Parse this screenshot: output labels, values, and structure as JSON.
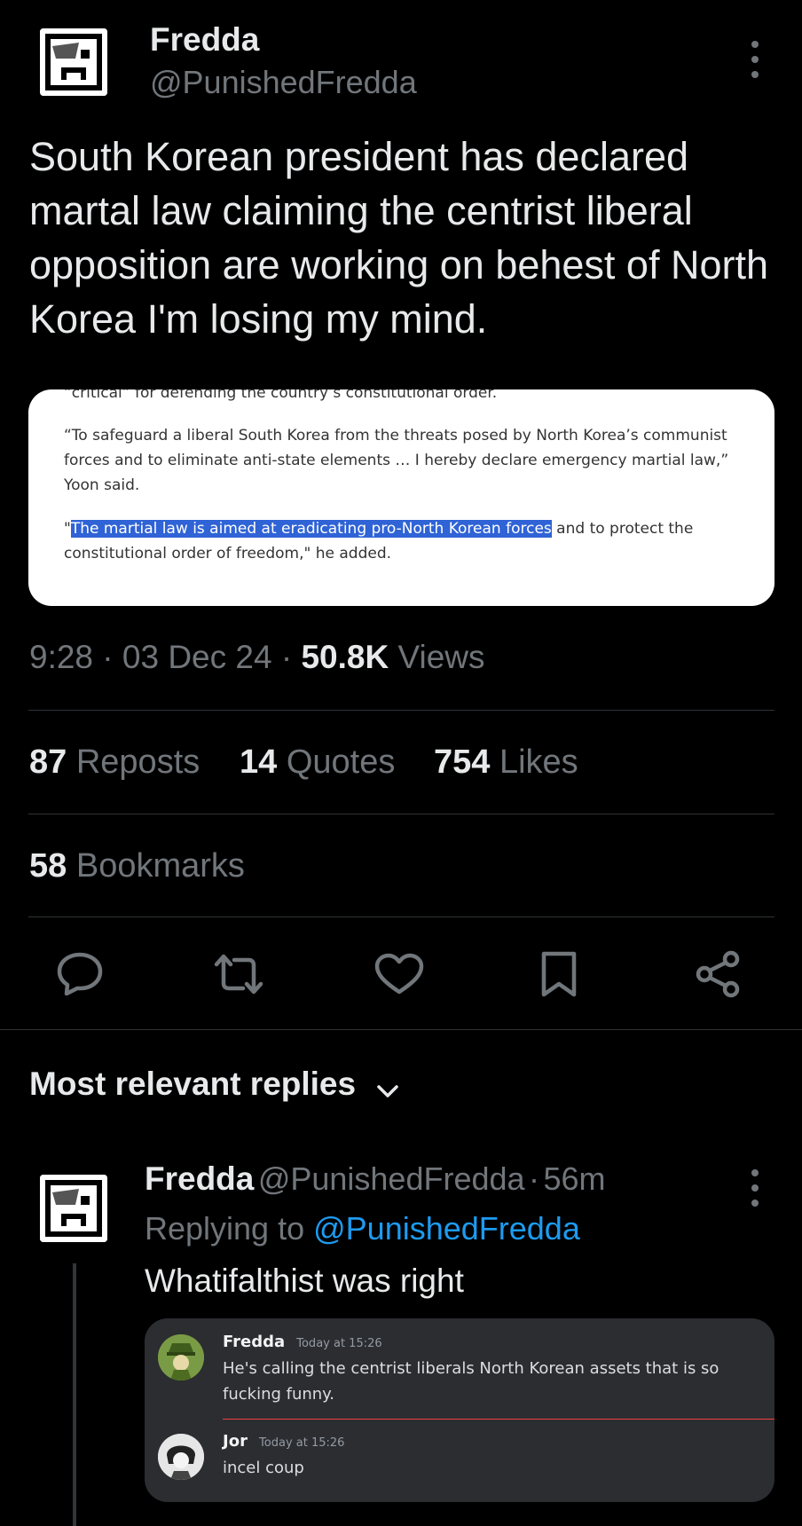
{
  "tweet": {
    "author_name": "Fredda",
    "author_handle": "@PunishedFredda",
    "text": "South Korean president has declared martal law claiming the centrist liberal opposition are working on behest of North Korea I'm losing my mind.",
    "embed": {
      "cut_line": "“critical” for defending the country’s constitutional order.",
      "para1": "“To safeguard a liberal South Korea from the threats posed by North Korea’s communist forces and to eliminate anti-state elements … I hereby declare emergency martial law,” Yoon said.",
      "quote_open": "\"",
      "highlight": "The martial law is aimed at eradicating pro-North Korean forces",
      "para2_rest": " and to protect the constitutional order of freedom,\" he added."
    },
    "time": "9:28",
    "date": "03 Dec 24",
    "views_count": "50.8K",
    "views_label": "Views",
    "reposts_count": "87",
    "reposts_label": "Reposts",
    "quotes_count": "14",
    "quotes_label": "Quotes",
    "likes_count": "754",
    "likes_label": "Likes",
    "bookmarks_count": "58",
    "bookmarks_label": "Bookmarks",
    "icons": [
      "reply-icon",
      "repost-icon",
      "like-icon",
      "bookmark-icon",
      "share-icon"
    ]
  },
  "replies": {
    "section_title": "Most relevant replies",
    "reply": {
      "author_name": "Fredda",
      "author_handle": "@PunishedFredda",
      "age": "56m",
      "replying_to_label": "Replying to",
      "replying_to_handle": "@PunishedFredda",
      "text": "Whatifalthist was right",
      "discord": {
        "messages": [
          {
            "name": "Fredda",
            "time": "Today at 15:26",
            "text": "He's calling the centrist liberals North Korean assets that is so fucking funny."
          },
          {
            "name": "Jor",
            "time": "Today at 15:26",
            "text": "incel coup"
          }
        ],
        "colors": {
          "bg": "#2b2d31",
          "divider": "#f23f43"
        }
      }
    }
  },
  "colors": {
    "background": "#000000",
    "text": "#e7e9ea",
    "secondary": "#71767b",
    "link": "#1d9bf0",
    "divider": "#2f3336"
  }
}
